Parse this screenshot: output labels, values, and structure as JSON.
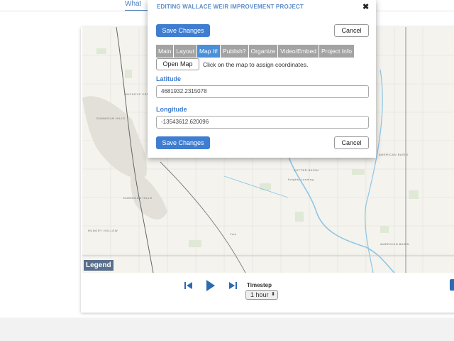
{
  "page": {
    "top_tab": "What"
  },
  "map": {
    "labels": [
      "BUCKEYE CREEK",
      "DUNNIGAN HILLS",
      "DUNNIGAN HILLS",
      "HUNGRY HOLLOW",
      "SUTTER BASIN",
      "AMERICAN BASIN",
      "AMERICAN BASIN",
      "Yolo",
      "Knights Landing"
    ],
    "legend_label": "Legend"
  },
  "controls": {
    "timestep_label": "Timestep",
    "timestep_value": "1 hour"
  },
  "modal": {
    "title": "EDITING WALLACE WEIR IMPROVEMENT PROJECT",
    "close_glyph": "✖",
    "save_label": "Save Changes",
    "cancel_label": "Cancel",
    "tabs": [
      {
        "label": "Main"
      },
      {
        "label": "Layout"
      },
      {
        "label": "Map It!"
      },
      {
        "label": "Publish?"
      },
      {
        "label": "Organize"
      },
      {
        "label": "Video/Embed"
      },
      {
        "label": "Project Info"
      }
    ],
    "active_tab": "Map It!",
    "open_map_label": "Open Map",
    "hint": "Click on the map to assign coordinates.",
    "latitude_label": "Latitude",
    "latitude_value": "4681932.2315078",
    "longitude_label": "Longitude",
    "longitude_value": "-13543612.620096"
  },
  "colors": {
    "accent": "#3f7dd1",
    "tab_active": "#4a90d9",
    "tab_inactive": "#a3a3a3",
    "title": "#5b8cc9"
  }
}
